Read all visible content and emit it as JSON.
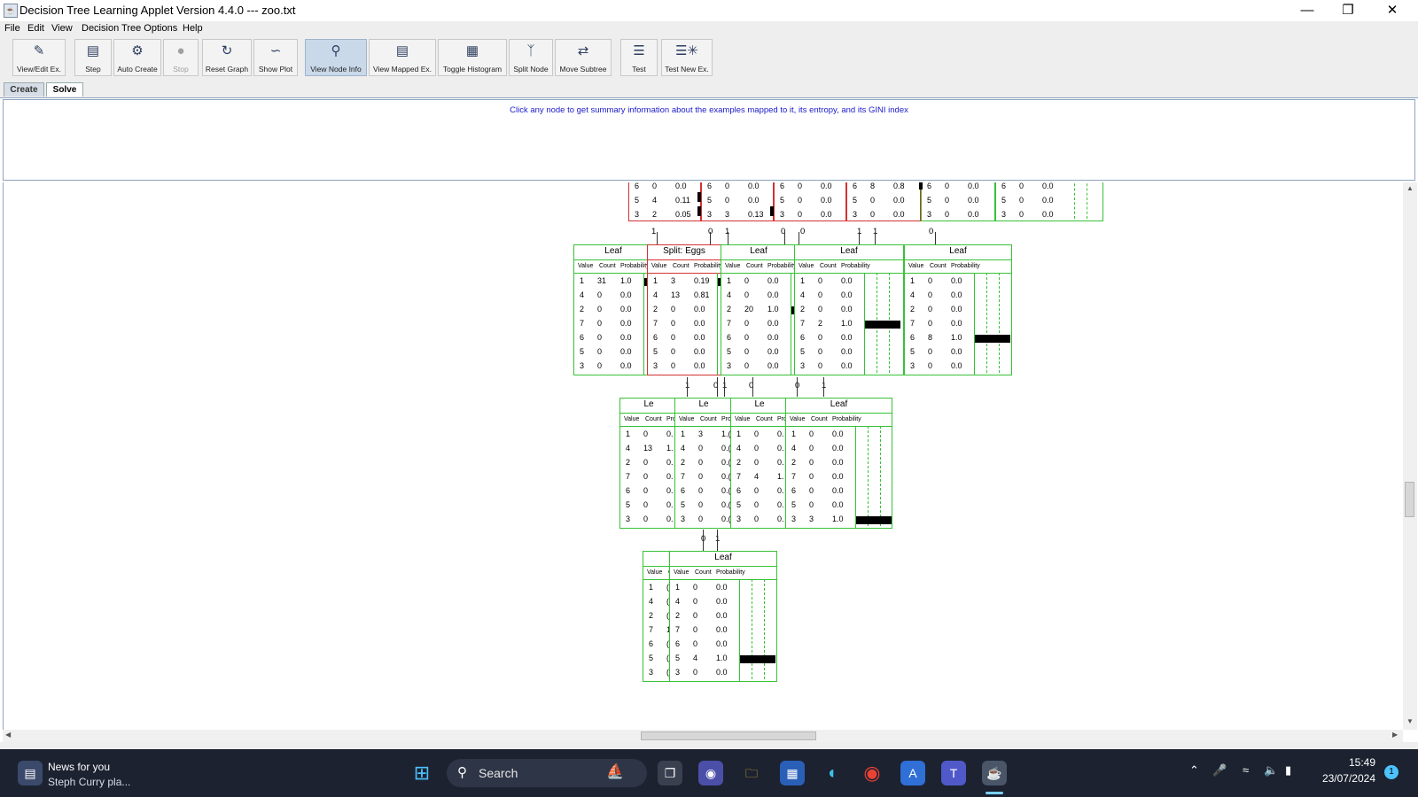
{
  "window": {
    "title": "Decision Tree Learning Applet Version 4.4.0 --- zoo.txt"
  },
  "menu": [
    "File",
    "Edit",
    "View",
    "Decision Tree Options",
    "Help"
  ],
  "toolbar": [
    {
      "label": "View/Edit Ex.",
      "icon": "edit-icon"
    },
    {
      "label": "Step",
      "icon": "step-icon"
    },
    {
      "label": "Auto Create",
      "icon": "auto-create-icon"
    },
    {
      "label": "Stop",
      "icon": "stop-icon",
      "disabled": true
    },
    {
      "label": "Reset Graph",
      "icon": "reset-icon"
    },
    {
      "label": "Show Plot",
      "icon": "plot-icon"
    },
    {
      "label": "View Node Info",
      "icon": "node-info-icon",
      "active": true
    },
    {
      "label": "View Mapped Ex.",
      "icon": "mapped-ex-icon"
    },
    {
      "label": "Toggle Histogram",
      "icon": "histogram-icon"
    },
    {
      "label": "Split Node",
      "icon": "split-node-icon"
    },
    {
      "label": "Move Subtree",
      "icon": "move-subtree-icon"
    },
    {
      "label": "Test",
      "icon": "test-icon"
    },
    {
      "label": "Test New Ex.",
      "icon": "test-new-icon"
    }
  ],
  "tabs": [
    "Create",
    "Solve"
  ],
  "active_tab": "Solve",
  "info": {
    "message": "Click any node to get summary information about the examples mapped to it, its entropy, and its GINI index"
  },
  "tree": {
    "col_headers": {
      "value": "Value",
      "count": "Count",
      "probability": "Probability"
    },
    "partial_rows_top": [
      {
        "cells": [
          [
            "6",
            "0",
            "0.0"
          ],
          [
            "6",
            "0",
            "0.0"
          ],
          [
            "6",
            "0",
            "0.0"
          ],
          [
            "6",
            "8",
            "0.8"
          ],
          [
            "6",
            "0",
            "0.0"
          ],
          [
            "6",
            "0",
            "0.0"
          ]
        ]
      },
      {
        "cells": [
          [
            "5",
            "4",
            "0.11"
          ],
          [
            "5",
            "0",
            "0.0"
          ],
          [
            "5",
            "0",
            "0.0"
          ],
          [
            "5",
            "0",
            "0.0"
          ],
          [
            "5",
            "0",
            "0.0"
          ],
          [
            "5",
            "0",
            "0.0"
          ]
        ]
      },
      {
        "cells": [
          [
            "3",
            "2",
            "0.05"
          ],
          [
            "3",
            "3",
            "0.13"
          ],
          [
            "3",
            "0",
            "0.0"
          ],
          [
            "3",
            "0",
            "0.0"
          ],
          [
            "3",
            "0",
            "0.0"
          ],
          [
            "3",
            "0",
            "0.0"
          ]
        ]
      }
    ],
    "level1": [
      {
        "title": "Leaf",
        "rows": [
          [
            "1",
            "31",
            "1.0"
          ],
          [
            "4",
            "0",
            "0.0"
          ],
          [
            "2",
            "0",
            "0.0"
          ],
          [
            "7",
            "0",
            "0.0"
          ],
          [
            "6",
            "0",
            "0.0"
          ],
          [
            "5",
            "0",
            "0.0"
          ],
          [
            "3",
            "0",
            "0.0"
          ]
        ],
        "bar": 1.0,
        "bar_row": 0
      },
      {
        "title": "Split: Eggs",
        "rows": [
          [
            "1",
            "3",
            "0.19"
          ],
          [
            "4",
            "13",
            "0.81"
          ],
          [
            "2",
            "0",
            "0.0"
          ],
          [
            "7",
            "0",
            "0.0"
          ],
          [
            "6",
            "0",
            "0.0"
          ],
          [
            "5",
            "0",
            "0.0"
          ],
          [
            "3",
            "0",
            "0.0"
          ]
        ],
        "bar": 0.19,
        "bar_row": 0
      },
      {
        "title": "Leaf",
        "rows": [
          [
            "1",
            "0",
            "0.0"
          ],
          [
            "4",
            "0",
            "0.0"
          ],
          [
            "2",
            "20",
            "1.0"
          ],
          [
            "7",
            "0",
            "0.0"
          ],
          [
            "6",
            "0",
            "0.0"
          ],
          [
            "5",
            "0",
            "0.0"
          ],
          [
            "3",
            "0",
            "0.0"
          ]
        ],
        "bar": 1.0,
        "bar_row": 2
      },
      {
        "title": "Leaf",
        "rows": [
          [
            "1",
            "0",
            "0.0"
          ],
          [
            "4",
            "0",
            "0.0"
          ],
          [
            "2",
            "0",
            "0.0"
          ],
          [
            "7",
            "2",
            "1.0"
          ],
          [
            "6",
            "0",
            "0.0"
          ],
          [
            "5",
            "0",
            "0.0"
          ],
          [
            "3",
            "0",
            "0.0"
          ]
        ],
        "bar": 1.0,
        "bar_row": 3
      },
      {
        "title": "Leaf",
        "rows": [
          [
            "1",
            "0",
            "0.0"
          ],
          [
            "4",
            "0",
            "0.0"
          ],
          [
            "2",
            "0",
            "0.0"
          ],
          [
            "7",
            "0",
            "0.0"
          ],
          [
            "6",
            "8",
            "1.0"
          ],
          [
            "5",
            "0",
            "0.0"
          ],
          [
            "3",
            "0",
            "0.0"
          ]
        ],
        "bar": 1.0,
        "bar_row": 4
      }
    ],
    "level2": [
      {
        "title": "Le",
        "rows": [
          [
            "1",
            "0",
            "0."
          ],
          [
            "4",
            "13",
            "1."
          ],
          [
            "2",
            "0",
            "0."
          ],
          [
            "7",
            "0",
            "0."
          ],
          [
            "6",
            "0",
            "0."
          ],
          [
            "5",
            "0",
            "0."
          ],
          [
            "3",
            "0",
            "0."
          ]
        ]
      },
      {
        "title": "Le",
        "rows": [
          [
            "1",
            "3",
            "1.("
          ],
          [
            "4",
            "0",
            "0.("
          ],
          [
            "2",
            "0",
            "0.("
          ],
          [
            "7",
            "0",
            "0.("
          ],
          [
            "6",
            "0",
            "0.("
          ],
          [
            "5",
            "0",
            "0.("
          ],
          [
            "3",
            "0",
            "0.("
          ]
        ]
      },
      {
        "title": "Le",
        "rows": [
          [
            "1",
            "0",
            "0."
          ],
          [
            "4",
            "0",
            "0."
          ],
          [
            "2",
            "0",
            "0."
          ],
          [
            "7",
            "4",
            "1."
          ],
          [
            "6",
            "0",
            "0."
          ],
          [
            "5",
            "0",
            "0."
          ],
          [
            "3",
            "0",
            "0."
          ]
        ]
      },
      {
        "title": "Leaf",
        "rows": [
          [
            "1",
            "0",
            "0.0"
          ],
          [
            "4",
            "0",
            "0.0"
          ],
          [
            "2",
            "0",
            "0.0"
          ],
          [
            "7",
            "0",
            "0.0"
          ],
          [
            "6",
            "0",
            "0.0"
          ],
          [
            "5",
            "0",
            "0.0"
          ],
          [
            "3",
            "3",
            "1.0"
          ]
        ],
        "bar": 1.0,
        "bar_row": 6
      }
    ],
    "level3": [
      {
        "title": "",
        "rows": [
          [
            "1",
            "("
          ],
          [
            "4",
            "("
          ],
          [
            "2",
            "("
          ],
          [
            "7",
            "1"
          ],
          [
            "6",
            "("
          ],
          [
            "5",
            "("
          ],
          [
            "3",
            "("
          ]
        ]
      },
      {
        "title": "Leaf",
        "rows": [
          [
            "1",
            "0",
            "0.0"
          ],
          [
            "4",
            "0",
            "0.0"
          ],
          [
            "2",
            "0",
            "0.0"
          ],
          [
            "7",
            "0",
            "0.0"
          ],
          [
            "6",
            "0",
            "0.0"
          ],
          [
            "5",
            "4",
            "1.0"
          ],
          [
            "3",
            "0",
            "0.0"
          ]
        ],
        "bar": 1.0,
        "bar_row": 5
      }
    ],
    "edge_labels": {
      "top": [
        "1",
        "0",
        "1",
        "0",
        "0",
        "1",
        "1",
        "0"
      ],
      "mid": [
        "1",
        "0",
        "1",
        "0",
        "0",
        "1"
      ],
      "low": [
        "0",
        "1"
      ]
    }
  },
  "taskbar": {
    "news_title": "News for you",
    "news_sub": "Steph Curry pla...",
    "search_label": "Search",
    "time": "15:49",
    "date": "23/07/2024",
    "notification_count": "1"
  }
}
